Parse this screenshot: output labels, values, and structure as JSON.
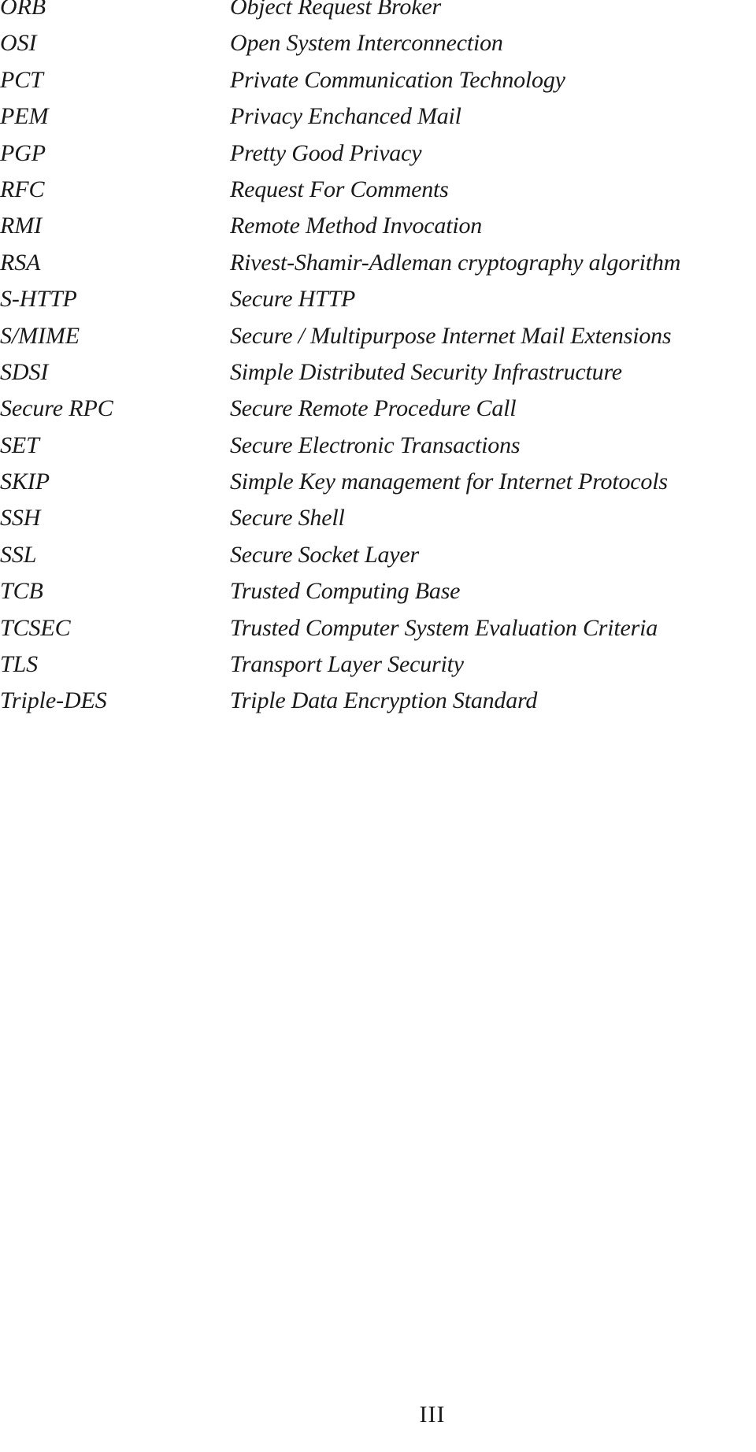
{
  "page": {
    "page_number": "III"
  },
  "glossary": {
    "entries": [
      {
        "term": "ORB",
        "definition": "Object Request Broker"
      },
      {
        "term": "OSI",
        "definition": "Open System Interconnection"
      },
      {
        "term": "PCT",
        "definition": "Private Communication Technology"
      },
      {
        "term": "PEM",
        "definition": "Privacy Enchanced Mail"
      },
      {
        "term": "PGP",
        "definition": "Pretty Good Privacy"
      },
      {
        "term": "RFC",
        "definition": "Request For Comments"
      },
      {
        "term": "RMI",
        "definition": "Remote Method Invocation"
      },
      {
        "term": "RSA",
        "definition": "Rivest-Shamir-Adleman cryptography algorithm"
      },
      {
        "term": "S-HTTP",
        "definition": "Secure HTTP"
      },
      {
        "term": "S/MIME",
        "definition": "Secure / Multipurpose Internet Mail Extensions"
      },
      {
        "term": "SDSI",
        "definition": "Simple Distributed Security Infrastructure"
      },
      {
        "term": "Secure RPC",
        "definition": "Secure Remote Procedure Call"
      },
      {
        "term": "SET",
        "definition": "Secure Electronic Transactions"
      },
      {
        "term": "SKIP",
        "definition": "Simple Key management for Internet Protocols"
      },
      {
        "term": "SSH",
        "definition": "Secure Shell"
      },
      {
        "term": "SSL",
        "definition": "Secure Socket Layer"
      },
      {
        "term": "TCB",
        "definition": "Trusted Computing Base"
      },
      {
        "term": "TCSEC",
        "definition": "Trusted Computer System Evaluation Criteria"
      },
      {
        "term": "TLS",
        "definition": "Transport Layer Security"
      },
      {
        "term": "Triple-DES",
        "definition": "Triple Data Encryption Standard"
      }
    ]
  }
}
